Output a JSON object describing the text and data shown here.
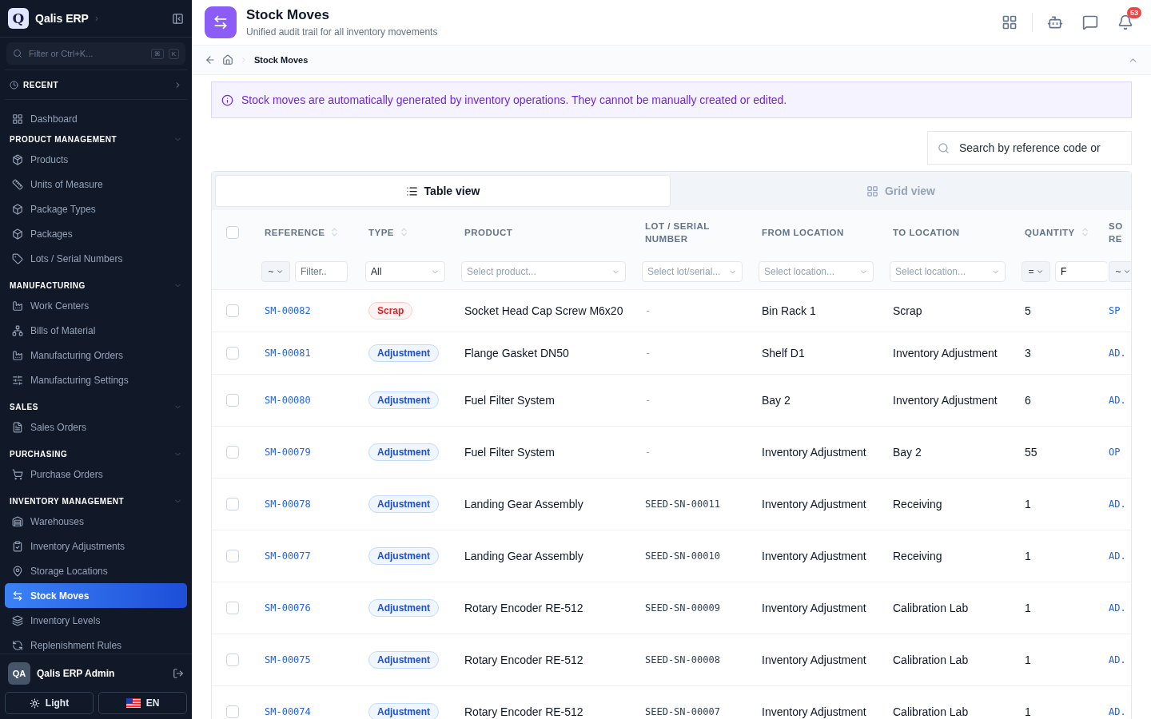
{
  "sidebar": {
    "brand": {
      "logo": "Q",
      "name": "Qalis ERP",
      "expand": "›"
    },
    "filter": {
      "placeholder": "Filter or Ctrl+K...",
      "keys": [
        "⌘",
        "K"
      ]
    },
    "recent": {
      "label": "RECENT"
    },
    "top_items": [
      {
        "label": "Dashboard",
        "selected": false
      }
    ],
    "sections": [
      {
        "title": "PRODUCT MANAGEMENT",
        "expanded": true,
        "items": [
          {
            "label": "Products",
            "selected": false
          },
          {
            "label": "Units of Measure",
            "selected": false
          },
          {
            "label": "Package Types",
            "selected": false
          },
          {
            "label": "Packages",
            "selected": false
          },
          {
            "label": "Lots / Serial Numbers",
            "selected": false
          }
        ]
      },
      {
        "title": "MANUFACTURING",
        "expanded": true,
        "items": [
          {
            "label": "Work Centers",
            "selected": false
          },
          {
            "label": "Bills of Material",
            "selected": false
          },
          {
            "label": "Manufacturing Orders",
            "selected": false
          },
          {
            "label": "Manufacturing Settings",
            "selected": false
          }
        ]
      },
      {
        "title": "SALES",
        "expanded": true,
        "items": [
          {
            "label": "Sales Orders",
            "selected": false
          }
        ]
      },
      {
        "title": "PURCHASING",
        "expanded": true,
        "items": [
          {
            "label": "Purchase Orders",
            "selected": false
          }
        ]
      },
      {
        "title": "INVENTORY MANAGEMENT",
        "expanded": true,
        "items": [
          {
            "label": "Warehouses",
            "selected": false
          },
          {
            "label": "Inventory Adjustments",
            "selected": false
          },
          {
            "label": "Storage Locations",
            "selected": false
          },
          {
            "label": "Stock Moves",
            "selected": true
          },
          {
            "label": "Inventory Levels",
            "selected": false
          },
          {
            "label": "Replenishment Rules",
            "selected": false
          }
        ]
      }
    ],
    "user": {
      "initials": "QA",
      "name": "Qalis ERP Admin"
    },
    "theme_button": "Light",
    "language_button": "EN"
  },
  "header": {
    "title": "Stock Moves",
    "subtitle": "Unified audit trail for all inventory movements",
    "notification_count": "53"
  },
  "breadcrumb": [
    "Stock Moves"
  ],
  "notice": "Stock moves are automatically generated by inventory operations. They cannot be manually created or edited.",
  "search": {
    "placeholder": "Search by reference code or"
  },
  "view_tabs": [
    {
      "label": "Table view",
      "selected": true
    },
    {
      "label": "Grid view",
      "selected": false
    }
  ],
  "table": {
    "select_all_checked": false,
    "columns": [
      {
        "label": "REFERENCE",
        "sortable": true
      },
      {
        "label": "TYPE",
        "sortable": true
      },
      {
        "label": "PRODUCT",
        "sortable": false
      },
      {
        "label": "LOT / SERIAL NUMBER",
        "sortable": false
      },
      {
        "label": "FROM LOCATION",
        "sortable": false
      },
      {
        "label": "TO LOCATION",
        "sortable": false
      },
      {
        "label": "QUANTITY",
        "sortable": true
      },
      {
        "label": "SO RE"
      }
    ],
    "filters": [
      {
        "kind": "op-text",
        "op": "~",
        "placeholder": "Filter.."
      },
      {
        "kind": "select",
        "value": "All"
      },
      {
        "kind": "select",
        "placeholder": "Select product..."
      },
      {
        "kind": "select",
        "placeholder": "Select lot/serial..."
      },
      {
        "kind": "select",
        "placeholder": "Select location..."
      },
      {
        "kind": "select",
        "placeholder": "Select location..."
      },
      {
        "kind": "op-text",
        "op": "=",
        "value": "F"
      },
      {
        "kind": "op",
        "op": "~"
      }
    ],
    "rows": [
      {
        "checked": false,
        "reference": "SM-00082",
        "type": "Scrap",
        "kind": "scrap",
        "product": "Socket Head Cap Screw M6x20",
        "lot": "-",
        "from": "Bin Rack 1",
        "to": "Scrap",
        "quantity": "5",
        "column_9": "SP"
      },
      {
        "checked": false,
        "reference": "SM-00081",
        "type": "Adjustment",
        "kind": "adjustment",
        "product": "Flange Gasket DN50",
        "lot": "-",
        "from": "Shelf D1",
        "to": "Inventory Adjustment",
        "quantity": "3",
        "column_9": "AD."
      },
      {
        "checked": false,
        "reference": "SM-00080",
        "type": "Adjustment",
        "kind": "adjustment",
        "product": "Fuel Filter System",
        "lot": "-",
        "from": "Bay 2",
        "to": "Inventory Adjustment",
        "quantity": "6",
        "column_9": "AD."
      },
      {
        "checked": false,
        "reference": "SM-00079",
        "type": "Adjustment",
        "kind": "adjustment",
        "product": "Fuel Filter System",
        "lot": "-",
        "from": "Inventory Adjustment",
        "to": "Bay 2",
        "quantity": "55",
        "column_9": "OP"
      },
      {
        "checked": false,
        "reference": "SM-00078",
        "type": "Adjustment",
        "kind": "adjustment",
        "product": "Landing Gear Assembly",
        "lot": "SEED-SN-00011",
        "from": "Inventory Adjustment",
        "to": "Receiving",
        "quantity": "1",
        "column_9": "AD."
      },
      {
        "checked": false,
        "reference": "SM-00077",
        "type": "Adjustment",
        "kind": "adjustment",
        "product": "Landing Gear Assembly",
        "lot": "SEED-SN-00010",
        "from": "Inventory Adjustment",
        "to": "Receiving",
        "quantity": "1",
        "column_9": "AD."
      },
      {
        "checked": false,
        "reference": "SM-00076",
        "type": "Adjustment",
        "kind": "adjustment",
        "product": "Rotary Encoder RE-512",
        "lot": "SEED-SN-00009",
        "from": "Inventory Adjustment",
        "to": "Calibration Lab",
        "quantity": "1",
        "column_9": "AD."
      },
      {
        "checked": false,
        "reference": "SM-00075",
        "type": "Adjustment",
        "kind": "adjustment",
        "product": "Rotary Encoder RE-512",
        "lot": "SEED-SN-00008",
        "from": "Inventory Adjustment",
        "to": "Calibration Lab",
        "quantity": "1",
        "column_9": "AD."
      },
      {
        "checked": false,
        "reference": "SM-00074",
        "type": "Adjustment",
        "kind": "adjustment",
        "product": "Rotary Encoder RE-512",
        "lot": "SEED-SN-00007",
        "from": "Inventory Adjustment",
        "to": "Calibration Lab",
        "quantity": "1",
        "column_9": "AD."
      }
    ]
  }
}
